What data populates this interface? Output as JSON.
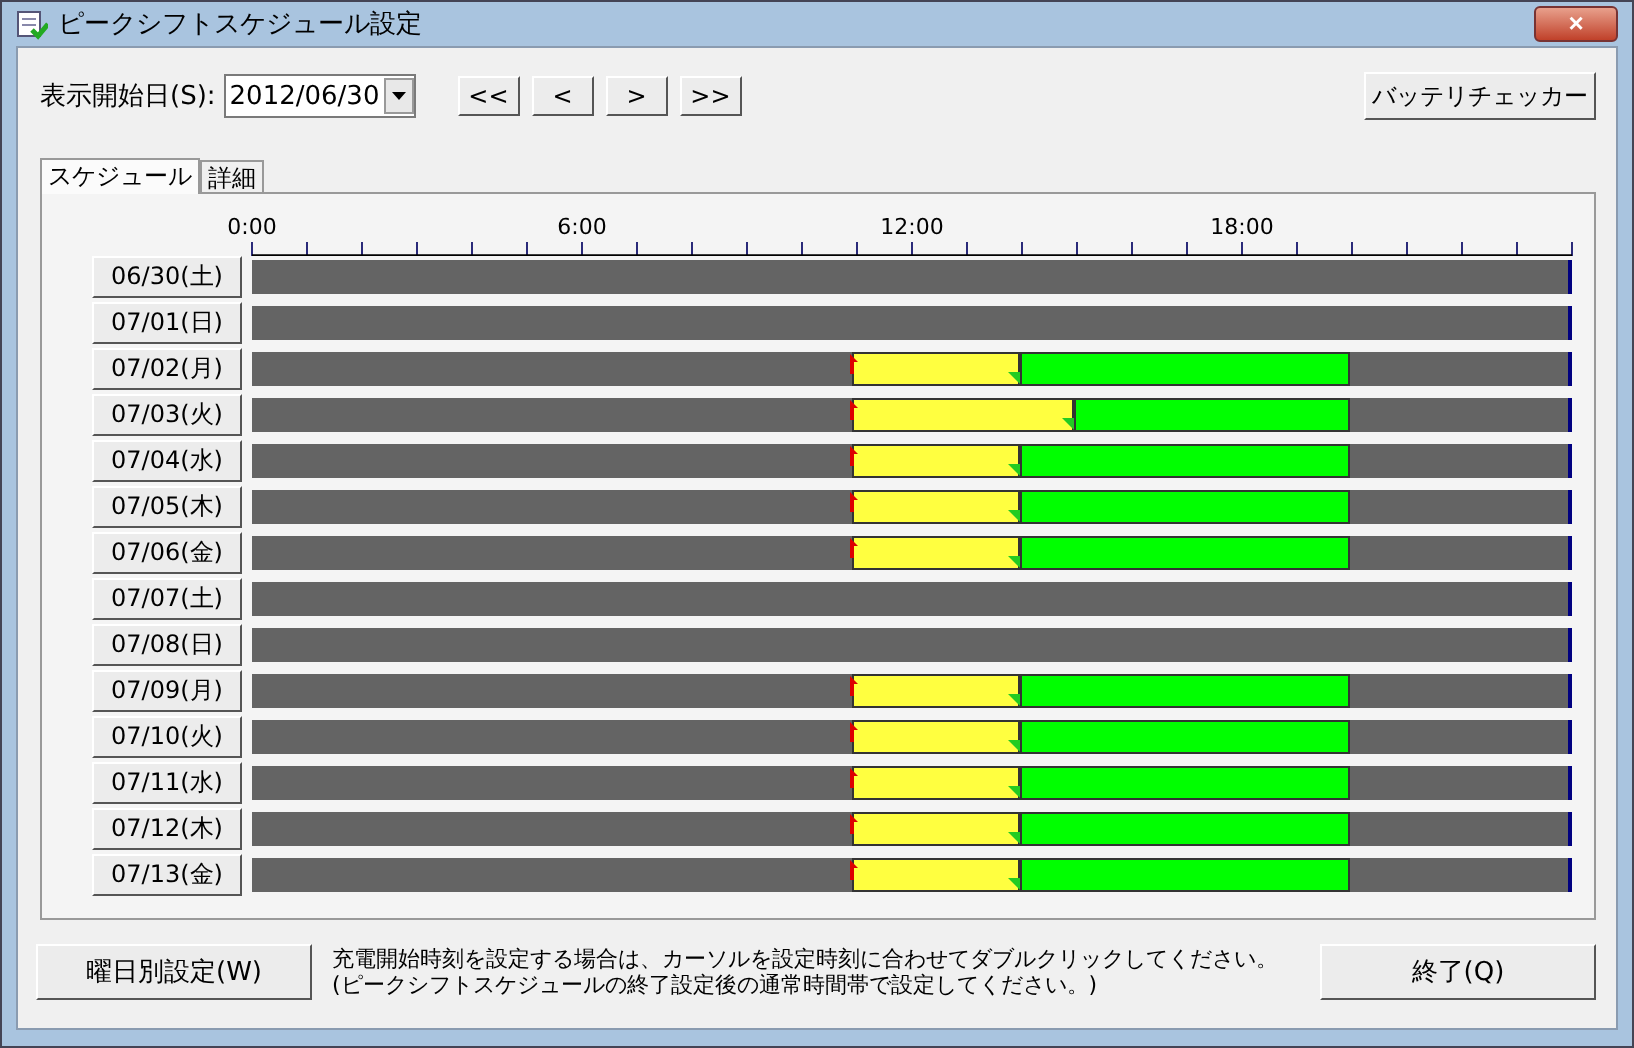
{
  "window": {
    "title": "ピークシフトスケジュール設定",
    "close": "×"
  },
  "toolbar": {
    "date_label": "表示開始日(S):",
    "date_value": "2012/06/30",
    "nav_buttons": [
      "<<",
      "<",
      ">",
      ">>"
    ],
    "battery_button": "バッテリチェッカー"
  },
  "tabs": [
    {
      "label": "スケジュール",
      "selected": true
    },
    {
      "label": "詳細",
      "selected": false
    }
  ],
  "timeline": {
    "hour_labels": [
      "0:00",
      "6:00",
      "12:00",
      "18:00"
    ]
  },
  "rows": [
    {
      "date": "06/30(土)"
    },
    {
      "date": "07/01(日)"
    },
    {
      "date": "07/02(月)",
      "slots": [
        {
          "kind": "off"
        },
        {
          "kind": "off"
        },
        {
          "kind": "off"
        },
        {
          "kind": "off"
        },
        {
          "kind": "off"
        },
        {
          "kind": "off"
        },
        {
          "kind": "off"
        },
        {
          "kind": "off"
        },
        {
          "kind": "off"
        },
        {
          "kind": "off"
        },
        {
          "kind": "off"
        },
        {
          "kind": "peak"
        },
        {
          "kind": "peak"
        },
        {
          "kind": "peak"
        },
        {
          "kind": "charge"
        },
        {
          "kind": "charge"
        },
        {
          "kind": "charge"
        },
        {
          "kind": "charge"
        },
        {
          "kind": "charge"
        },
        {
          "kind": "charge"
        },
        {
          "kind": "off"
        },
        {
          "kind": "off"
        },
        {
          "kind": "off"
        },
        {
          "kind": "off"
        }
      ]
    },
    {
      "date": "07/03(火)",
      "slots": [
        {
          "kind": "off"
        },
        {
          "kind": "off"
        },
        {
          "kind": "off"
        },
        {
          "kind": "off"
        },
        {
          "kind": "off"
        },
        {
          "kind": "off"
        },
        {
          "kind": "off"
        },
        {
          "kind": "off"
        },
        {
          "kind": "off"
        },
        {
          "kind": "off"
        },
        {
          "kind": "off"
        },
        {
          "kind": "peak"
        },
        {
          "kind": "peak"
        },
        {
          "kind": "peak"
        },
        {
          "kind": "peak"
        },
        {
          "kind": "charge"
        },
        {
          "kind": "charge"
        },
        {
          "kind": "charge"
        },
        {
          "kind": "charge"
        },
        {
          "kind": "charge"
        },
        {
          "kind": "off"
        },
        {
          "kind": "off"
        },
        {
          "kind": "off"
        },
        {
          "kind": "off"
        }
      ]
    },
    {
      "date": "07/04(水)",
      "slots": [
        {
          "kind": "off"
        },
        {
          "kind": "off"
        },
        {
          "kind": "off"
        },
        {
          "kind": "off"
        },
        {
          "kind": "off"
        },
        {
          "kind": "off"
        },
        {
          "kind": "off"
        },
        {
          "kind": "off"
        },
        {
          "kind": "off"
        },
        {
          "kind": "off"
        },
        {
          "kind": "off"
        },
        {
          "kind": "peak"
        },
        {
          "kind": "peak"
        },
        {
          "kind": "peak"
        },
        {
          "kind": "charge"
        },
        {
          "kind": "charge"
        },
        {
          "kind": "charge"
        },
        {
          "kind": "charge"
        },
        {
          "kind": "charge"
        },
        {
          "kind": "charge"
        },
        {
          "kind": "off"
        },
        {
          "kind": "off"
        },
        {
          "kind": "off"
        },
        {
          "kind": "off"
        }
      ]
    },
    {
      "date": "07/05(木)",
      "slots": [
        {
          "kind": "off"
        },
        {
          "kind": "off"
        },
        {
          "kind": "off"
        },
        {
          "kind": "off"
        },
        {
          "kind": "off"
        },
        {
          "kind": "off"
        },
        {
          "kind": "off"
        },
        {
          "kind": "off"
        },
        {
          "kind": "off"
        },
        {
          "kind": "off"
        },
        {
          "kind": "off"
        },
        {
          "kind": "peak"
        },
        {
          "kind": "peak"
        },
        {
          "kind": "peak"
        },
        {
          "kind": "charge"
        },
        {
          "kind": "charge"
        },
        {
          "kind": "charge"
        },
        {
          "kind": "charge"
        },
        {
          "kind": "charge"
        },
        {
          "kind": "charge"
        },
        {
          "kind": "off"
        },
        {
          "kind": "off"
        },
        {
          "kind": "off"
        },
        {
          "kind": "off"
        }
      ]
    },
    {
      "date": "07/06(金)",
      "slots": [
        {
          "kind": "off"
        },
        {
          "kind": "off"
        },
        {
          "kind": "off"
        },
        {
          "kind": "off"
        },
        {
          "kind": "off"
        },
        {
          "kind": "off"
        },
        {
          "kind": "off"
        },
        {
          "kind": "off"
        },
        {
          "kind": "off"
        },
        {
          "kind": "off"
        },
        {
          "kind": "off"
        },
        {
          "kind": "peak"
        },
        {
          "kind": "peak"
        },
        {
          "kind": "peak"
        },
        {
          "kind": "charge"
        },
        {
          "kind": "charge"
        },
        {
          "kind": "charge"
        },
        {
          "kind": "charge"
        },
        {
          "kind": "charge"
        },
        {
          "kind": "charge"
        },
        {
          "kind": "off"
        },
        {
          "kind": "off"
        },
        {
          "kind": "off"
        },
        {
          "kind": "off"
        }
      ]
    },
    {
      "date": "07/07(土)"
    },
    {
      "date": "07/08(日)"
    },
    {
      "date": "07/09(月)",
      "slots": [
        {
          "kind": "off"
        },
        {
          "kind": "off"
        },
        {
          "kind": "off"
        },
        {
          "kind": "off"
        },
        {
          "kind": "off"
        },
        {
          "kind": "off"
        },
        {
          "kind": "off"
        },
        {
          "kind": "off"
        },
        {
          "kind": "off"
        },
        {
          "kind": "off"
        },
        {
          "kind": "off"
        },
        {
          "kind": "peak"
        },
        {
          "kind": "peak"
        },
        {
          "kind": "peak"
        },
        {
          "kind": "charge"
        },
        {
          "kind": "charge"
        },
        {
          "kind": "charge"
        },
        {
          "kind": "charge"
        },
        {
          "kind": "charge"
        },
        {
          "kind": "charge"
        },
        {
          "kind": "off"
        },
        {
          "kind": "off"
        },
        {
          "kind": "off"
        },
        {
          "kind": "off"
        }
      ]
    },
    {
      "date": "07/10(火)",
      "slots": [
        {
          "kind": "off"
        },
        {
          "kind": "off"
        },
        {
          "kind": "off"
        },
        {
          "kind": "off"
        },
        {
          "kind": "off"
        },
        {
          "kind": "off"
        },
        {
          "kind": "off"
        },
        {
          "kind": "off"
        },
        {
          "kind": "off"
        },
        {
          "kind": "off"
        },
        {
          "kind": "off"
        },
        {
          "kind": "peak"
        },
        {
          "kind": "peak"
        },
        {
          "kind": "peak"
        },
        {
          "kind": "charge"
        },
        {
          "kind": "charge"
        },
        {
          "kind": "charge"
        },
        {
          "kind": "charge"
        },
        {
          "kind": "charge"
        },
        {
          "kind": "charge"
        },
        {
          "kind": "off"
        },
        {
          "kind": "off"
        },
        {
          "kind": "off"
        },
        {
          "kind": "off"
        }
      ]
    },
    {
      "date": "07/11(水)",
      "slots": [
        {
          "kind": "off"
        },
        {
          "kind": "off"
        },
        {
          "kind": "off"
        },
        {
          "kind": "off"
        },
        {
          "kind": "off"
        },
        {
          "kind": "off"
        },
        {
          "kind": "off"
        },
        {
          "kind": "off"
        },
        {
          "kind": "off"
        },
        {
          "kind": "off"
        },
        {
          "kind": "off"
        },
        {
          "kind": "peak"
        },
        {
          "kind": "peak"
        },
        {
          "kind": "peak"
        },
        {
          "kind": "charge"
        },
        {
          "kind": "charge"
        },
        {
          "kind": "charge"
        },
        {
          "kind": "charge"
        },
        {
          "kind": "charge"
        },
        {
          "kind": "charge"
        },
        {
          "kind": "off"
        },
        {
          "kind": "off"
        },
        {
          "kind": "off"
        },
        {
          "kind": "off"
        }
      ]
    },
    {
      "date": "07/12(木)",
      "slots": [
        {
          "kind": "off"
        },
        {
          "kind": "off"
        },
        {
          "kind": "off"
        },
        {
          "kind": "off"
        },
        {
          "kind": "off"
        },
        {
          "kind": "off"
        },
        {
          "kind": "off"
        },
        {
          "kind": "off"
        },
        {
          "kind": "off"
        },
        {
          "kind": "off"
        },
        {
          "kind": "off"
        },
        {
          "kind": "peak"
        },
        {
          "kind": "peak"
        },
        {
          "kind": "peak"
        },
        {
          "kind": "charge"
        },
        {
          "kind": "charge"
        },
        {
          "kind": "charge"
        },
        {
          "kind": "charge"
        },
        {
          "kind": "charge"
        },
        {
          "kind": "charge"
        },
        {
          "kind": "off"
        },
        {
          "kind": "off"
        },
        {
          "kind": "off"
        },
        {
          "kind": "off"
        }
      ]
    },
    {
      "date": "07/13(金)",
      "slots": [
        {
          "kind": "off"
        },
        {
          "kind": "off"
        },
        {
          "kind": "off"
        },
        {
          "kind": "off"
        },
        {
          "kind": "off"
        },
        {
          "kind": "off"
        },
        {
          "kind": "off"
        },
        {
          "kind": "off"
        },
        {
          "kind": "off"
        },
        {
          "kind": "off"
        },
        {
          "kind": "off"
        },
        {
          "kind": "peak"
        },
        {
          "kind": "peak"
        },
        {
          "kind": "peak"
        },
        {
          "kind": "charge"
        },
        {
          "kind": "charge"
        },
        {
          "kind": "charge"
        },
        {
          "kind": "charge"
        },
        {
          "kind": "charge"
        },
        {
          "kind": "charge"
        },
        {
          "kind": "off"
        },
        {
          "kind": "off"
        },
        {
          "kind": "off"
        },
        {
          "kind": "off"
        }
      ]
    }
  ],
  "footer": {
    "weekday_button": "曜日別設定(W)",
    "help_text": [
      "充電開始時刻を設定する場合は、カーソルを設定時刻に合わせてダブルクリックしてください。",
      "(ピークシフトスケジュールの終了設定後の通常時間帯で設定してください。)"
    ],
    "exit_button": "終了(Q)"
  }
}
